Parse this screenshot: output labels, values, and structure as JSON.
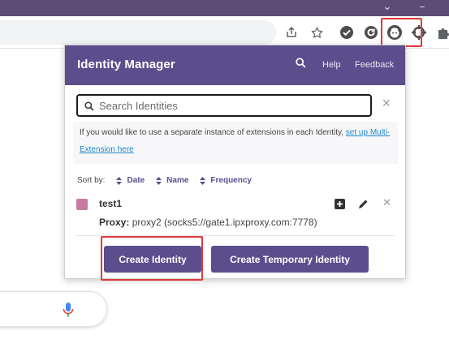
{
  "browser": {
    "window_controls": [
      "⌄",
      "–"
    ],
    "toolbar_icons": [
      "share-icon",
      "star-icon",
      "checkmark-extension-icon",
      "refresh-extension-icon",
      "identity-manager-extension-icon",
      "crosshair-extension-icon",
      "puzzle-extension-icon"
    ]
  },
  "popup": {
    "title": "Identity Manager",
    "header_links": {
      "help": "Help",
      "feedback": "Feedback"
    },
    "search": {
      "placeholder": "Search Identities"
    },
    "notice": {
      "text": "If you would like to use a separate instance of extensions in each Identity, ",
      "link_text": "set up Multi-Extension here"
    },
    "sort": {
      "label": "Sort by:",
      "options": [
        "Date",
        "Name",
        "Frequency"
      ]
    },
    "identities": [
      {
        "name": "test1",
        "color": "#c87aa0",
        "proxy_label": "Proxy:",
        "proxy_value": "proxy2 (socks5://gate1.ipxproxy.com:7778)"
      }
    ],
    "buttons": {
      "create": "Create Identity",
      "create_temporary": "Create Temporary Identity"
    }
  },
  "colors": {
    "accent": "#5c4d8d",
    "highlight": "#e03a3a",
    "link": "#1e88c9"
  }
}
